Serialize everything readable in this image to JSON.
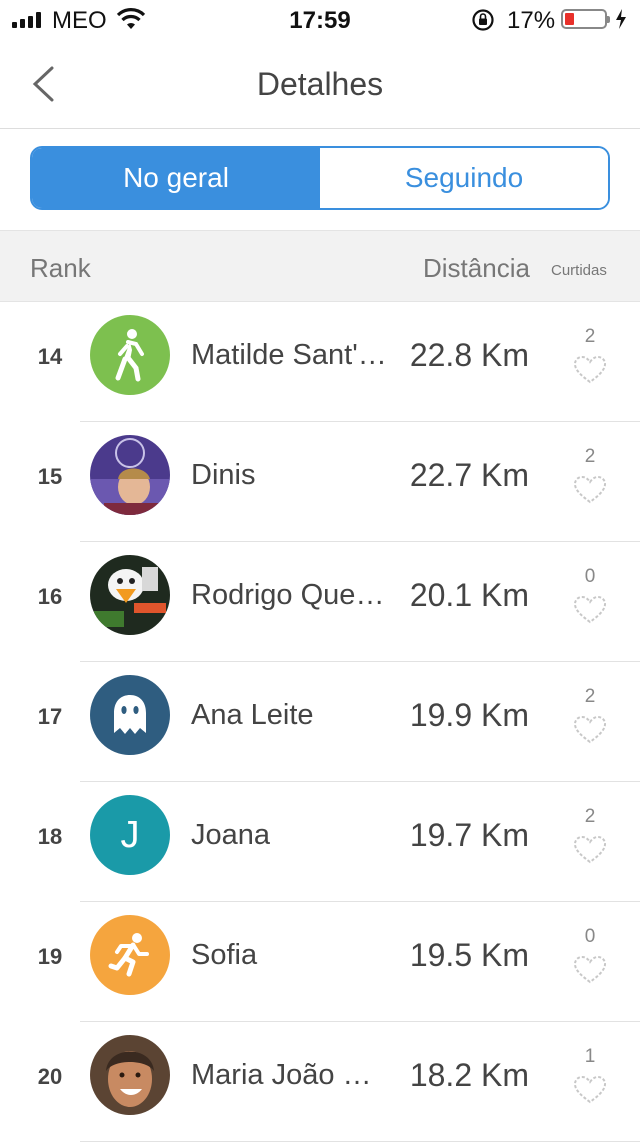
{
  "status_bar": {
    "carrier": "MEO",
    "time": "17:59",
    "battery": "17%"
  },
  "nav": {
    "title": "Detalhes"
  },
  "tabs": [
    {
      "label": "No geral",
      "active": true
    },
    {
      "label": "Seguindo",
      "active": false
    }
  ],
  "table_header": {
    "rank": "Rank",
    "distance": "Distância",
    "likes": "Curtidas"
  },
  "rows": [
    {
      "rank": "14",
      "name": "Matilde Sant'Anna",
      "distance": "22.8 Km",
      "likes": "2",
      "avatar": "walk-icon",
      "avatar_color": "#7dc04f"
    },
    {
      "rank": "15",
      "name": "Dinis",
      "distance": "22.7 Km",
      "likes": "2",
      "avatar": "photo",
      "avatar_color": "#4b3a8c"
    },
    {
      "rank": "16",
      "name": "Rodrigo Queirós",
      "distance": "20.1 Km",
      "likes": "0",
      "avatar": "photo",
      "avatar_color": "#2a2a2a"
    },
    {
      "rank": "17",
      "name": "Ana Leite",
      "distance": "19.9 Km",
      "likes": "2",
      "avatar": "ghost-icon",
      "avatar_color": "#2f5d80"
    },
    {
      "rank": "18",
      "name": "Joana",
      "distance": "19.7 Km",
      "likes": "2",
      "avatar": "J",
      "avatar_color": "#1a9aa8"
    },
    {
      "rank": "19",
      "name": "Sofia",
      "distance": "19.5 Km",
      "likes": "0",
      "avatar": "run-icon",
      "avatar_color": "#f5a53e"
    },
    {
      "rank": "20",
      "name": "Maria João Silva",
      "distance": "18.2 Km",
      "likes": "1",
      "avatar": "photo",
      "avatar_color": "#a86f4a"
    }
  ]
}
